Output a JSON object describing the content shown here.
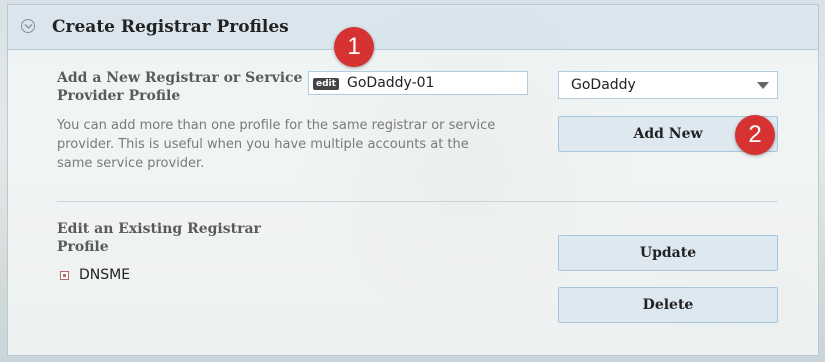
{
  "panel": {
    "title": "Create Registrar Profiles"
  },
  "add_section": {
    "label_line1": "Add a New Registrar or Service",
    "label_line2": "Provider Profile",
    "edit_tag": "edit",
    "name_value": "GoDaddy-01",
    "registrar_selected": "GoDaddy",
    "help_text": "You can add more than one profile for the same registrar or service provider. This is useful when you have multiple accounts at the same service provider.",
    "add_button": "Add New"
  },
  "edit_section": {
    "label_line1": "Edit an Existing Registrar",
    "label_line2": "Profile",
    "profiles": [
      "DNSME"
    ],
    "update_button": "Update",
    "delete_button": "Delete"
  },
  "annotations": {
    "marker1": "1",
    "marker2": "2"
  },
  "colors": {
    "header_bg": "#d6e3ec",
    "button_bg": "#dde8f1",
    "marker_red": "#d73232"
  }
}
